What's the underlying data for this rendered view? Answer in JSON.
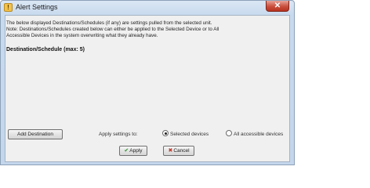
{
  "window": {
    "title": "Alert Settings",
    "icon": "alert-bell-icon",
    "close_glyph": "✕"
  },
  "info": {
    "line1": "The below displayed Destinations/Schedules (if any) are settings pulled from the selected unit.",
    "line2": "Note: Destinations/Schedules created below can either be applied to the Selected Device or to All",
    "line3": "Accessible Devices in the system overwriting what they already have."
  },
  "section": {
    "title": "Destination/Schedule (max: 5)"
  },
  "actions": {
    "add_destination_label": "Add Destination",
    "apply_settings_label": "Apply settings to:",
    "radio_selected_label": "Selected devices",
    "radio_all_label": "All accessible devices",
    "selected_option": "Selected devices"
  },
  "footer": {
    "apply_label": "Apply",
    "cancel_label": "Cancel",
    "apply_glyph": "✔",
    "cancel_glyph": "✖"
  },
  "colors": {
    "titlebar": "#c8daee",
    "close_button": "#c9503e",
    "client_background": "#f0f0f0"
  }
}
